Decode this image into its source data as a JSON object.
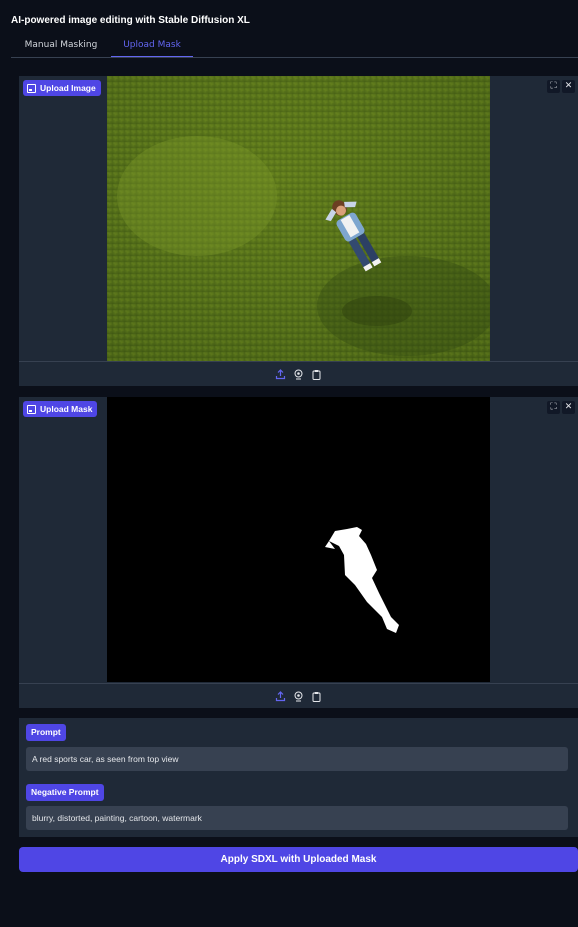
{
  "app": {
    "title": "AI-powered image editing with Stable Diffusion XL"
  },
  "tabs": [
    {
      "label": "Manual Masking",
      "active": false
    },
    {
      "label": "Upload Mask",
      "active": true
    }
  ],
  "image_upload": {
    "label": "Upload Image",
    "icons": {
      "fullscreen": "fullscreen-icon",
      "clear": "close-icon",
      "upload": "upload-icon",
      "webcam": "webcam-icon",
      "clipboard": "clipboard-icon"
    }
  },
  "mask_upload": {
    "label": "Upload Mask"
  },
  "prompt": {
    "label": "Prompt",
    "value": "A red sports car, as seen from top view"
  },
  "negative_prompt": {
    "label": "Negative Prompt",
    "value": "blurry, distorted, painting, cartoon, watermark"
  },
  "apply_button": {
    "label": "Apply SDXL with Uploaded Mask"
  },
  "colors": {
    "background": "#0b0f19",
    "panel": "#1f2937",
    "accent": "#4f46e5",
    "active_tab": "#6366f1"
  }
}
